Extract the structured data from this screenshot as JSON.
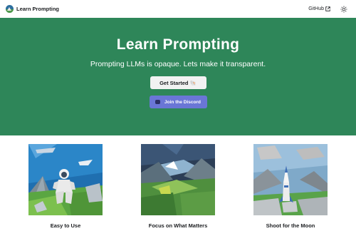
{
  "navbar": {
    "brand_title": "Learn Prompting",
    "github_label": "GitHub",
    "logo_icon": "globe-mountain-logo",
    "external_icon": "external-link-icon",
    "theme_icon": "sun-icon"
  },
  "hero": {
    "title": "Learn Prompting",
    "subtitle": "Prompting LLMs is opaque. Lets make it transparent.",
    "get_started_label": "Get Started 🐚",
    "discord_label": "Join the Discord",
    "discord_icon": "discord-icon",
    "background_color": "#2e8659"
  },
  "features": [
    {
      "caption": "Easy to Use",
      "image": "astronaut-lowpoly-illustration"
    },
    {
      "caption": "Focus on What Matters",
      "image": "mountain-sunrise-lowpoly-illustration"
    },
    {
      "caption": "Shoot for the Moon",
      "image": "rocket-lowpoly-illustration"
    }
  ]
}
